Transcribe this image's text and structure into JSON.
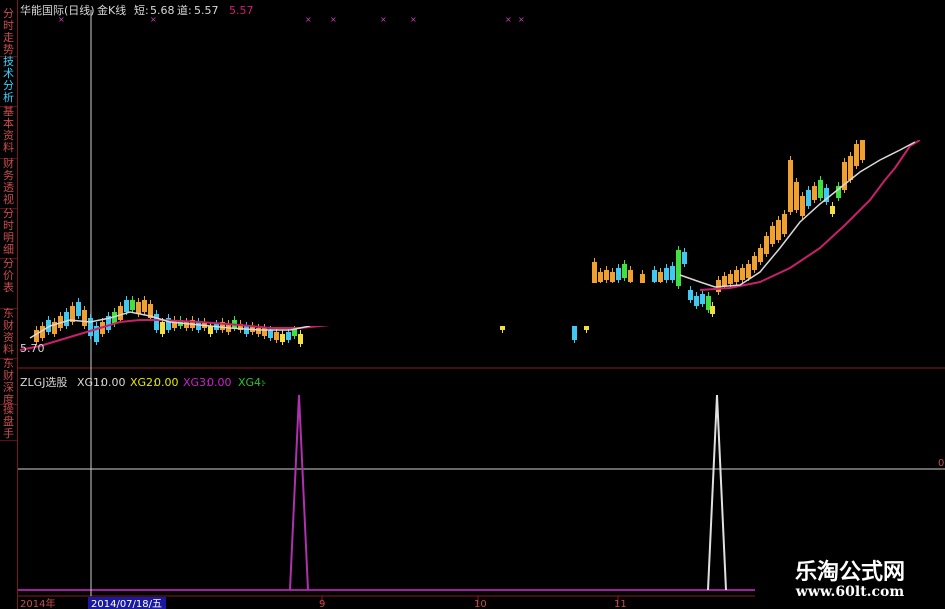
{
  "header": {
    "stock": "华能国际(日线)",
    "indicator": "金K线",
    "short_label": "短:",
    "short_value": "5.68",
    "channel_label": "道:",
    "channel_value": "5.57",
    "other_value": "5.57"
  },
  "left_tabs": [
    "分时走势",
    "技术分析",
    "基本资料",
    "财务透视",
    "分时明细",
    "分价表",
    "东财资料",
    "东财深度",
    "操盘手"
  ],
  "active_tab": 1,
  "price_axis_label": "5.70",
  "lower_panel": {
    "name": "ZLGJ选股",
    "items": [
      {
        "label": "XG1:",
        "value": "0.00",
        "color": "#d8d8d8"
      },
      {
        "label": "XG2:",
        "value": "0.00",
        "color": "#e8e800"
      },
      {
        "label": "XG3:",
        "value": "0.00",
        "color": "#d020d0"
      },
      {
        "label": "XG4:",
        "value": "-",
        "color": "#30c030"
      }
    ]
  },
  "time_axis": [
    "2014年",
    "2014/07/18/五",
    "9",
    "10",
    "11"
  ],
  "right_edge_label": "0",
  "watermark": {
    "title": "乐淘公式网",
    "url": "www.60lt.com"
  },
  "colors": {
    "up_orange": "#f0a030",
    "down_cyan": "#40c8f0",
    "yellow": "#f0e040",
    "green": "#40e040",
    "ma_white": "#e0e0e0",
    "ma_magenta": "#d02070",
    "signal_purple": "#b030b0",
    "signal_white": "#e0e0e0"
  },
  "chart_data": {
    "type": "candlestick",
    "signals": [
      {
        "name": "XG3",
        "color": "#b030b0",
        "position": "2014-08 late"
      },
      {
        "name": "XG1",
        "color": "#e0e0e0",
        "position": "2014-11 late"
      }
    ]
  }
}
